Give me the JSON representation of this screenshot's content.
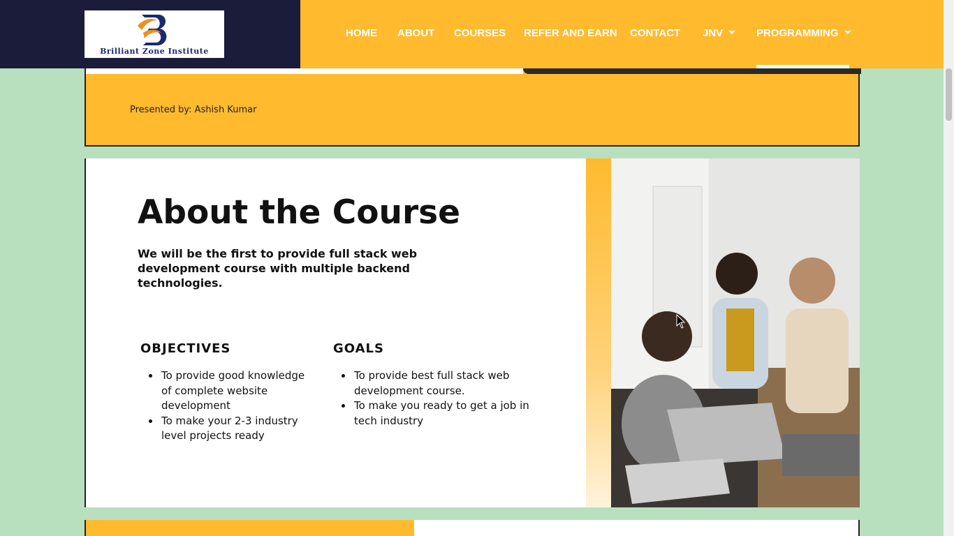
{
  "header": {
    "logo_letter": "B",
    "logo_text": "Brilliant Zone Institute",
    "nav_items": [
      {
        "label": "HOME"
      },
      {
        "label": "ABOUT"
      },
      {
        "label": "COURSES"
      },
      {
        "label": "REFER AND EARN"
      },
      {
        "label": "CONTACT"
      },
      {
        "label": "JNV"
      },
      {
        "label": "PROGRAMMING"
      }
    ],
    "active_item": "PROGRAMMING"
  },
  "slide1": {
    "presented_by": "Presented by: Ashish Kumar"
  },
  "slide2": {
    "title": "About the Course",
    "intro": "We will be the first to provide full stack web development course with multiple backend technologies.",
    "objectives": {
      "title": "OBJECTIVES",
      "items": [
        "To provide good knowledge of complete website development",
        "To make your 2-3 industry level projects ready"
      ]
    },
    "goals": {
      "title": "GOALS",
      "items": [
        "To provide best full stack web development course.",
        "To make you ready to get a job in tech industry"
      ]
    }
  },
  "colors": {
    "navy": "#1b1c3a",
    "accent_yellow": "#ffba2e",
    "page_background": "#b8e0bf",
    "logo_orange": "#f0901e",
    "logo_blue": "#1b2a6b"
  }
}
